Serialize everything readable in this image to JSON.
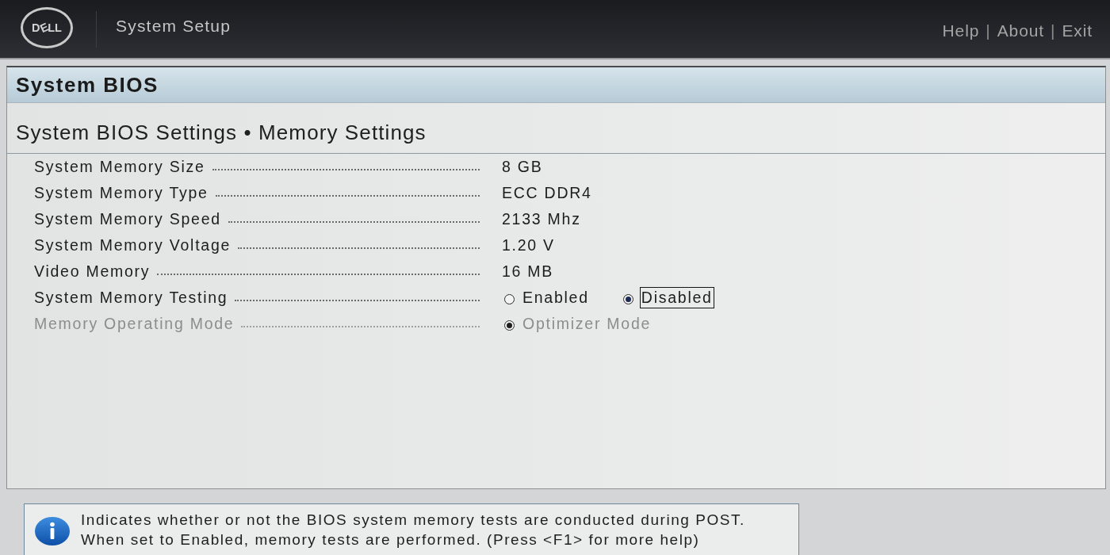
{
  "header": {
    "logo": "DELL",
    "title": "System Setup",
    "links": [
      {
        "label": "Help",
        "separator": "|"
      },
      {
        "label": "About",
        "separator": "|"
      },
      {
        "label": "Exit"
      }
    ]
  },
  "panel": {
    "title": "System BIOS",
    "breadcrumb": "System BIOS Settings • Memory Settings"
  },
  "settings": [
    {
      "kind": "text",
      "label": "System Memory Size",
      "value": "8 GB",
      "disabled": false
    },
    {
      "kind": "text",
      "label": "System Memory Type",
      "value": "ECC DDR4",
      "disabled": false
    },
    {
      "kind": "text",
      "label": "System Memory Speed",
      "value": "2133 Mhz",
      "disabled": false
    },
    {
      "kind": "text",
      "label": "System Memory Voltage",
      "value": "1.20 V",
      "disabled": false
    },
    {
      "kind": "text",
      "label": "Video Memory",
      "value": "16 MB",
      "disabled": false
    },
    {
      "kind": "radio",
      "label": "System Memory Testing",
      "disabled": false,
      "options": [
        {
          "label": "Enabled",
          "selected": false,
          "focused": false
        },
        {
          "label": "Disabled",
          "selected": true,
          "focused": true
        }
      ]
    },
    {
      "kind": "radio",
      "label": "Memory Operating Mode",
      "disabled": true,
      "options": [
        {
          "label": "Optimizer Mode",
          "selected": true,
          "focused": false
        }
      ]
    }
  ],
  "help": {
    "text": "Indicates whether or not the BIOS system memory tests are conducted during POST.\nWhen set to Enabled, memory tests are performed. (Press <F1> for more help)"
  }
}
